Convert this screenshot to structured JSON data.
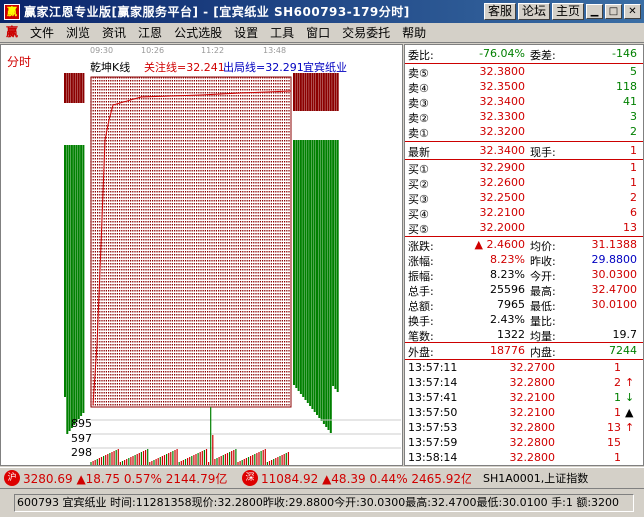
{
  "window": {
    "title": "赢家江恩专业版[赢家服务平台] - [宜宾纸业 SH600793-179分时]",
    "buttons": [
      "客服",
      "论坛",
      "主页"
    ]
  },
  "menu": [
    "文件",
    "浏览",
    "资讯",
    "江恩",
    "公式选股",
    "设置",
    "工具",
    "窗口",
    "交易委托",
    "帮助"
  ],
  "chart": {
    "period_label": "分时",
    "indicator": "乾坤K线",
    "line1": "关注线=32.241",
    "line2": "出局线=32.291",
    "stock": "宜宾纸业",
    "time_labels": [
      "09:30",
      "10:26",
      "11:22",
      "13:48"
    ],
    "vol_labels": [
      "895",
      "597",
      "298"
    ]
  },
  "chart_data": {
    "type": "bar",
    "title": "乾坤K线",
    "series": [
      {
        "name": "关注线",
        "value": 32.241
      },
      {
        "name": "出局线",
        "value": 32.291
      }
    ],
    "volume_ticks": [
      895,
      597,
      298
    ]
  },
  "quote": {
    "weibi_label": "委比:",
    "weibi": "-76.04%",
    "weicha_label": "委差:",
    "weicha": "-146",
    "asks": [
      {
        "l": "卖⑤",
        "p": "32.3800",
        "v": "5"
      },
      {
        "l": "卖④",
        "p": "32.3500",
        "v": "118"
      },
      {
        "l": "卖③",
        "p": "32.3400",
        "v": "41"
      },
      {
        "l": "卖②",
        "p": "32.3300",
        "v": "3"
      },
      {
        "l": "卖①",
        "p": "32.3200",
        "v": "2"
      }
    ],
    "last_label": "最新",
    "last": "32.3400",
    "xianshou_label": "现手:",
    "xianshou": "1",
    "bids": [
      {
        "l": "买①",
        "p": "32.2900",
        "v": "1"
      },
      {
        "l": "买②",
        "p": "32.2600",
        "v": "1"
      },
      {
        "l": "买③",
        "p": "32.2500",
        "v": "2"
      },
      {
        "l": "买④",
        "p": "32.2100",
        "v": "6"
      },
      {
        "l": "买⑤",
        "p": "32.2000",
        "v": "13"
      }
    ],
    "stats": [
      {
        "a": "涨跌:",
        "b": "▲ 2.4600",
        "c": "均价:",
        "d": "31.1388",
        "bc": "red",
        "dc": "red"
      },
      {
        "a": "涨幅:",
        "b": "8.23%",
        "c": "昨收:",
        "d": "29.8800",
        "bc": "red",
        "dc": "blu"
      },
      {
        "a": "振幅:",
        "b": "8.23%",
        "c": "今开:",
        "d": "30.0300",
        "bc": "blk",
        "dc": "red"
      },
      {
        "a": "总手:",
        "b": "25596",
        "c": "最高:",
        "d": "32.4700",
        "bc": "blk",
        "dc": "red"
      },
      {
        "a": "总额:",
        "b": "7965",
        "c": "最低:",
        "d": "30.0100",
        "bc": "blk",
        "dc": "red"
      },
      {
        "a": "换手:",
        "b": "2.43%",
        "c": "量比:",
        "d": "",
        "bc": "blk",
        "dc": "blk"
      },
      {
        "a": "笔数:",
        "b": "1322",
        "c": "均量:",
        "d": "19.7",
        "bc": "blk",
        "dc": "blk"
      }
    ],
    "waipan_label": "外盘:",
    "waipan": "18776",
    "neipan_label": "内盘:",
    "neipan": "7244",
    "ticks": [
      {
        "t": "13:57:11",
        "p": "32.2700",
        "v": "1",
        "a": ""
      },
      {
        "t": "13:57:14",
        "p": "32.2800",
        "v": "2",
        "a": "↑"
      },
      {
        "t": "13:57:41",
        "p": "32.2100",
        "v": "1",
        "a": "↓"
      },
      {
        "t": "13:57:50",
        "p": "32.2100",
        "v": "1",
        "a": "▲"
      },
      {
        "t": "13:57:53",
        "p": "32.2800",
        "v": "13",
        "a": "↑"
      },
      {
        "t": "13:57:59",
        "p": "32.2800",
        "v": "15",
        "a": ""
      },
      {
        "t": "13:58:14",
        "p": "32.2800",
        "v": "1",
        "a": ""
      }
    ]
  },
  "indexbar": {
    "sh_badge": "沪",
    "sh": "3280.69 ▲18.75 0.57% 2144.79亿",
    "sz_badge": "深",
    "sz": "11084.92 ▲48.39 0.44% 2465.92亿",
    "right": "SH1A0001,上证指数"
  },
  "status": "600793 宜宾纸业 时间:11281358现价:32.2800昨收:29.8800今开:30.0300最高:32.4700最低:30.0100 手:1 额:3200"
}
